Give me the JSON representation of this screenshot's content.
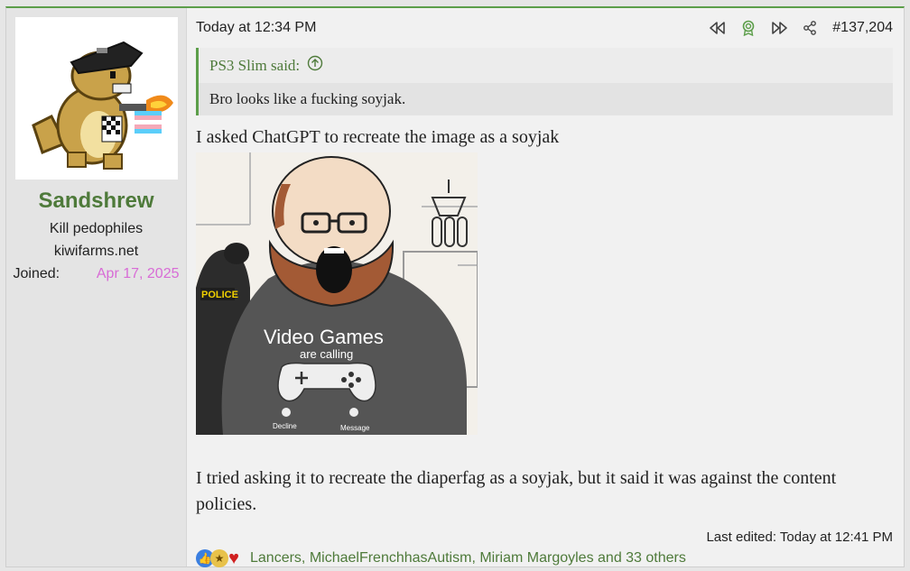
{
  "user": {
    "name": "Sandshrew",
    "title": "Kill pedophiles",
    "site": "kiwifarms.net",
    "joined_label": "Joined:",
    "joined_value": "Apr 17, 2025"
  },
  "post": {
    "date": "Today at 12:34 PM",
    "number": "#137,204",
    "quote": {
      "author": "PS3 Slim said:",
      "text": "Bro looks like a fucking soyjak."
    },
    "paragraph1": "I asked ChatGPT to recreate the image as a soyjak",
    "image_text": {
      "police": "POLICE",
      "shirt_line1": "Video Games",
      "shirt_line2": "are calling",
      "decline": "Decline",
      "message": "Message"
    },
    "paragraph2": "I tried asking it to recreate the diaperfag as a soyjak, but it said it was against the content policies.",
    "last_edited": "Last edited: Today at 12:41 PM",
    "reactions_text": "Lancers, MichaelFrenchhasAutism, Miriam Margoyles and 33 others"
  },
  "icons": {
    "prev": "rewind-icon",
    "award": "award-icon",
    "next": "fast-forward-icon",
    "share": "share-icon",
    "quote_up": "arrow-up-circle-icon"
  },
  "colors": {
    "accent_green": "#4e7a3a",
    "joined_pink": "#d86cd6"
  }
}
